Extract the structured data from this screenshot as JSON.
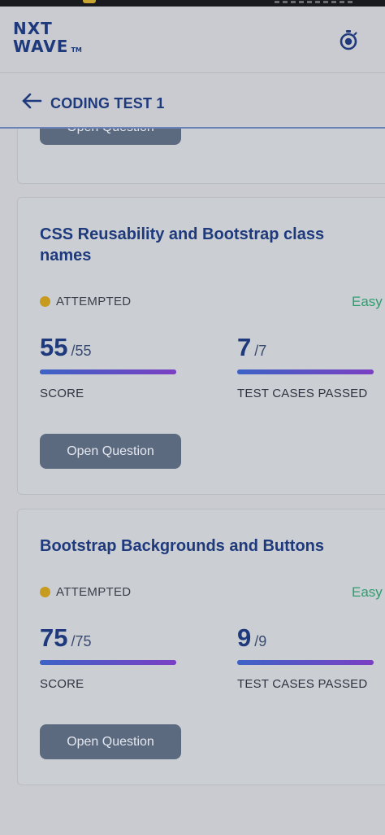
{
  "brand": {
    "line1": "NXT",
    "line2": "WAVE",
    "tm": "TM"
  },
  "header": {
    "timer_icon": "stopwatch-icon"
  },
  "subheader": {
    "back_icon": "arrow-left-icon",
    "title": "CODING TEST 1"
  },
  "colors": {
    "brand_blue": "#1e3a7c",
    "attempted_dot": "#c79b1e",
    "easy_green": "#2f9e6e",
    "button_bg": "#5c6a80",
    "bar_start": "#3d63c6",
    "bar_end": "#7b3fc4"
  },
  "questions": [
    {
      "open_label": "Open Question"
    },
    {
      "title": "CSS Reusability and Bootstrap class names",
      "status": "ATTEMPTED",
      "difficulty": "Easy",
      "score": {
        "value": "55",
        "total": "/55",
        "label": "SCORE",
        "fraction": 1.0
      },
      "tests": {
        "value": "7",
        "total": "/7",
        "label": "TEST CASES PASSED",
        "fraction": 1.0
      },
      "open_label": "Open Question"
    },
    {
      "title": "Bootstrap Backgrounds and Buttons",
      "status": "ATTEMPTED",
      "difficulty": "Easy",
      "score": {
        "value": "75",
        "total": "/75",
        "label": "SCORE",
        "fraction": 1.0
      },
      "tests": {
        "value": "9",
        "total": "/9",
        "label": "TEST CASES PASSED",
        "fraction": 1.0
      },
      "open_label": "Open Question"
    }
  ]
}
